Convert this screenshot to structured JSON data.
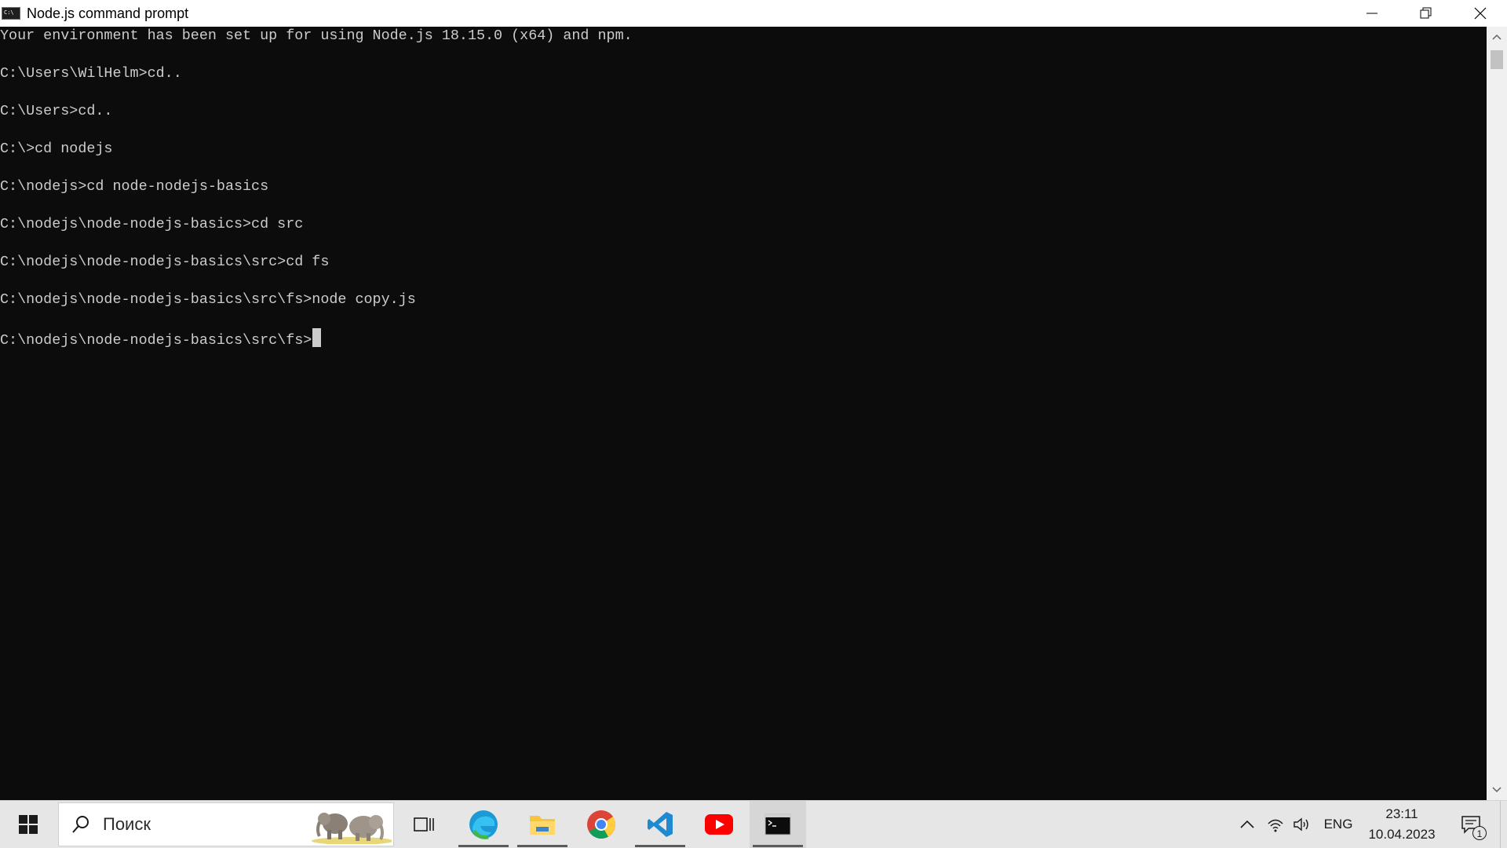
{
  "window": {
    "title": "Node.js command prompt"
  },
  "console": {
    "lines": [
      "Your environment has been set up for using Node.js 18.15.0 (x64) and npm.",
      "C:\\Users\\WilHelm>cd..",
      "C:\\Users>cd..",
      "C:\\>cd nodejs",
      "C:\\nodejs>cd node-nodejs-basics",
      "C:\\nodejs\\node-nodejs-basics>cd src",
      "C:\\nodejs\\node-nodejs-basics\\src>cd fs",
      "C:\\nodejs\\node-nodejs-basics\\src\\fs>node copy.js",
      "C:\\nodejs\\node-nodejs-basics\\src\\fs>"
    ],
    "text_color": "#cccccc",
    "background": "#0c0c0c"
  },
  "taskbar": {
    "search_placeholder": "Поиск",
    "apps": [
      "task-view",
      "edge",
      "file-explorer",
      "chrome",
      "vscode",
      "youtube",
      "command-prompt"
    ],
    "tray": {
      "language": "ENG",
      "time": "23:11",
      "date": "10.04.2023",
      "notification_count": "1"
    }
  }
}
